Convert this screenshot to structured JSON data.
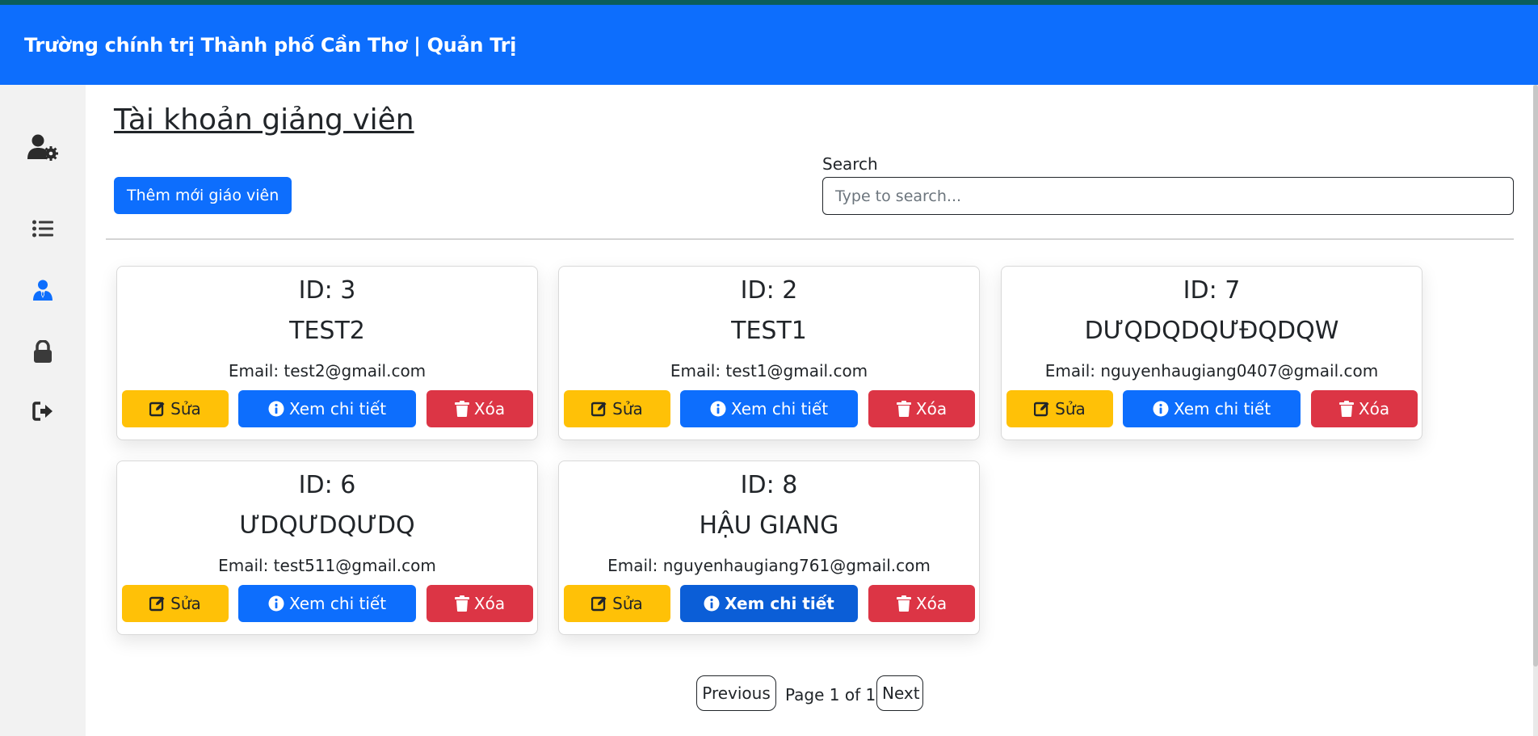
{
  "header": {
    "title": "Trường chính trị Thành phố Cần Thơ | Quản Trị"
  },
  "sidebar": {
    "items": [
      {
        "icon": "user-gear-icon"
      },
      {
        "icon": "list-icon"
      },
      {
        "icon": "user-tie-icon",
        "active": true
      },
      {
        "icon": "lock-icon"
      },
      {
        "icon": "sign-out-icon"
      }
    ]
  },
  "main": {
    "title": "Tài khoản giảng viên",
    "add_button": "Thêm mới giáo viên",
    "search": {
      "label": "Search",
      "placeholder": "Type to search...",
      "value": ""
    }
  },
  "cards": [
    {
      "id": "ID: 3",
      "name": "TEST2",
      "email": "Email: test2@gmail.com"
    },
    {
      "id": "ID: 2",
      "name": "TEST1",
      "email": "Email: test1@gmail.com"
    },
    {
      "id": "ID: 7",
      "name": "DƯQDQDQƯĐQDQW",
      "email": "Email: nguyenhaugiang0407@gmail.com"
    },
    {
      "id": "ID: 6",
      "name": "ƯDQƯDQƯDQ",
      "email": "Email: test511@gmail.com"
    },
    {
      "id": "ID: 8",
      "name": "HẬU GIANG",
      "email": "Email: nguyenhaugiang761@gmail.com"
    }
  ],
  "card_actions": {
    "edit": "Sửa",
    "view": "Xem chi tiết",
    "delete": "Xóa"
  },
  "pagination": {
    "previous": "Previous",
    "info": "Page 1 of 1",
    "next": "Next"
  },
  "colors": {
    "primary": "#0d6efd",
    "warning": "#ffc107",
    "danger": "#dc3545",
    "sidebar_bg": "#f2f2f2"
  }
}
